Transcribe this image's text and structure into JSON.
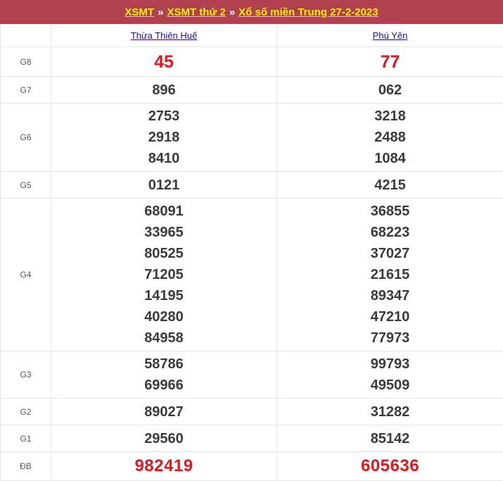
{
  "header": {
    "crumb1": "XSMT",
    "sep1": "»",
    "crumb2": "XSMT thứ 2",
    "sep2": "»",
    "crumb3": "Xổ số miền Trung 27-2-2023"
  },
  "provinces": [
    "Thừa Thiên Huế",
    "Phú Yên"
  ],
  "prizes": [
    {
      "label": "G8",
      "p1": [
        "45"
      ],
      "p2": [
        "77"
      ]
    },
    {
      "label": "G7",
      "p1": [
        "896"
      ],
      "p2": [
        "062"
      ]
    },
    {
      "label": "G6",
      "p1": [
        "2753",
        "2918",
        "8410"
      ],
      "p2": [
        "3218",
        "2488",
        "1084"
      ]
    },
    {
      "label": "G5",
      "p1": [
        "0121"
      ],
      "p2": [
        "4215"
      ]
    },
    {
      "label": "G4",
      "p1": [
        "68091",
        "33965",
        "80525",
        "71205",
        "14195",
        "40280",
        "84958"
      ],
      "p2": [
        "36855",
        "68223",
        "37027",
        "21615",
        "89347",
        "47210",
        "77973"
      ]
    },
    {
      "label": "G3",
      "p1": [
        "58786",
        "69966"
      ],
      "p2": [
        "99793",
        "49509"
      ]
    },
    {
      "label": "G2",
      "p1": [
        "89027"
      ],
      "p2": [
        "31282"
      ]
    },
    {
      "label": "G1",
      "p1": [
        "29560"
      ],
      "p2": [
        "85142"
      ]
    },
    {
      "label": "ĐB",
      "p1": [
        "982419"
      ],
      "p2": [
        "605636"
      ]
    }
  ],
  "colors": {
    "title_bg": "#b24150",
    "title_link": "#fff200",
    "highlight_red": "#e5161d",
    "province_link": "#1a0dab"
  }
}
